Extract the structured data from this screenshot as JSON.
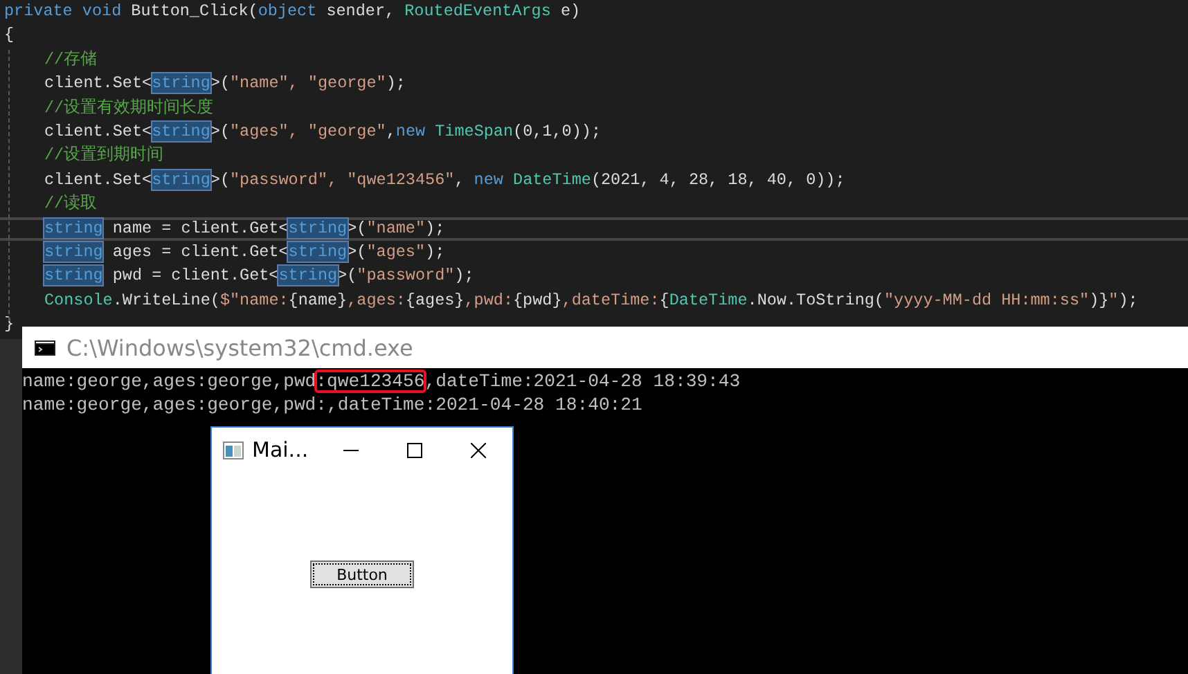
{
  "editor": {
    "lines": [
      {
        "kind": "top",
        "current": false,
        "segments": [
          {
            "text": "private void ",
            "kind": "keyword"
          },
          {
            "text": "Button_Click(",
            "kind": "plain"
          },
          {
            "text": "object ",
            "kind": "keyword"
          },
          {
            "text": "sender, ",
            "kind": "plain"
          },
          {
            "text": "RoutedEventArgs ",
            "kind": "type"
          },
          {
            "text": "e)",
            "kind": "plain"
          }
        ]
      },
      {
        "kind": "top",
        "current": false,
        "segments": [
          {
            "text": "{",
            "kind": "plain"
          }
        ]
      },
      {
        "kind": "body",
        "current": false,
        "segments": [
          {
            "text": "//存储",
            "kind": "comment"
          }
        ]
      },
      {
        "kind": "body",
        "current": false,
        "segments": [
          {
            "text": "client.Set<",
            "kind": "plain"
          },
          {
            "text": "string",
            "kind": "highlight"
          },
          {
            "text": ">(",
            "kind": "plain"
          },
          {
            "text": "\"name\", \"george\"",
            "kind": "string"
          },
          {
            "text": ");",
            "kind": "plain"
          }
        ]
      },
      {
        "kind": "body",
        "current": false,
        "segments": [
          {
            "text": "//设置有效期时间长度",
            "kind": "comment"
          }
        ]
      },
      {
        "kind": "body",
        "current": false,
        "segments": [
          {
            "text": "client.Set<",
            "kind": "plain"
          },
          {
            "text": "string",
            "kind": "highlight"
          },
          {
            "text": ">(",
            "kind": "plain"
          },
          {
            "text": "\"ages\", \"george\"",
            "kind": "string"
          },
          {
            "text": ",",
            "kind": "plain"
          },
          {
            "text": "new ",
            "kind": "keyword"
          },
          {
            "text": "TimeSpan",
            "kind": "type"
          },
          {
            "text": "(0,1,0));",
            "kind": "plain"
          }
        ]
      },
      {
        "kind": "body",
        "current": false,
        "segments": [
          {
            "text": "//设置到期时间",
            "kind": "comment"
          }
        ]
      },
      {
        "kind": "body",
        "current": false,
        "segments": [
          {
            "text": "client.Set<",
            "kind": "plain"
          },
          {
            "text": "string",
            "kind": "highlight"
          },
          {
            "text": ">(",
            "kind": "plain"
          },
          {
            "text": "\"password\", \"qwe123456\"",
            "kind": "string"
          },
          {
            "text": ", ",
            "kind": "plain"
          },
          {
            "text": "new ",
            "kind": "keyword"
          },
          {
            "text": "DateTime",
            "kind": "type"
          },
          {
            "text": "(2021, 4, 28, 18, 40, 0));",
            "kind": "plain"
          }
        ]
      },
      {
        "kind": "body",
        "current": false,
        "segments": [
          {
            "text": "//读取",
            "kind": "comment"
          }
        ]
      },
      {
        "kind": "body",
        "current": true,
        "segments": [
          {
            "text": "string",
            "kind": "highlight"
          },
          {
            "text": " name = client.Get<",
            "kind": "plain"
          },
          {
            "text": "string",
            "kind": "highlight"
          },
          {
            "text": ">(",
            "kind": "plain"
          },
          {
            "text": "\"name\"",
            "kind": "string"
          },
          {
            "text": ");",
            "kind": "plain"
          }
        ]
      },
      {
        "kind": "body",
        "current": false,
        "segments": [
          {
            "text": "string",
            "kind": "highlight"
          },
          {
            "text": " ages = client.Get<",
            "kind": "plain"
          },
          {
            "text": "string",
            "kind": "highlight"
          },
          {
            "text": ">(",
            "kind": "plain"
          },
          {
            "text": "\"ages\"",
            "kind": "string"
          },
          {
            "text": ");",
            "kind": "plain"
          }
        ]
      },
      {
        "kind": "body",
        "current": false,
        "segments": [
          {
            "text": "string",
            "kind": "highlight"
          },
          {
            "text": " pwd = client.Get<",
            "kind": "plain"
          },
          {
            "text": "string",
            "kind": "highlight"
          },
          {
            "text": ">(",
            "kind": "plain"
          },
          {
            "text": "\"password\"",
            "kind": "string"
          },
          {
            "text": ");",
            "kind": "plain"
          }
        ]
      },
      {
        "kind": "body",
        "current": false,
        "segments": [
          {
            "text": "Console",
            "kind": "type"
          },
          {
            "text": ".WriteLine(",
            "kind": "plain"
          },
          {
            "text": "$\"name:",
            "kind": "string"
          },
          {
            "text": "{name}",
            "kind": "plain"
          },
          {
            "text": ",ages:",
            "kind": "string"
          },
          {
            "text": "{ages}",
            "kind": "plain"
          },
          {
            "text": ",pwd:",
            "kind": "string"
          },
          {
            "text": "{pwd}",
            "kind": "plain"
          },
          {
            "text": ",dateTime:",
            "kind": "string"
          },
          {
            "text": "{",
            "kind": "plain"
          },
          {
            "text": "DateTime",
            "kind": "type"
          },
          {
            "text": ".Now.ToString(",
            "kind": "plain"
          },
          {
            "text": "\"yyyy-MM-dd HH:mm:ss\"",
            "kind": "string"
          },
          {
            "text": ")}",
            "kind": "plain"
          },
          {
            "text": "\"",
            "kind": "string"
          },
          {
            "text": ");",
            "kind": "plain"
          }
        ]
      },
      {
        "kind": "top",
        "current": false,
        "segments": [
          {
            "text": "}",
            "kind": "plain"
          }
        ]
      }
    ]
  },
  "console": {
    "title": "C:\\Windows\\system32\\cmd.exe",
    "lines": [
      {
        "segments": [
          {
            "text": "name:george,ages:george,pwd",
            "boxed": false
          },
          {
            "text": ":qwe123456",
            "boxed": true
          },
          {
            "text": ",dateTime:2021-04-28 18:39:43",
            "boxed": false
          }
        ]
      },
      {
        "segments": [
          {
            "text": "name:george,ages:george,pwd:,dateTime:2021-04-28 18:40:21",
            "boxed": false
          }
        ]
      }
    ]
  },
  "app_window": {
    "title": "Mai...",
    "button": "Button"
  }
}
